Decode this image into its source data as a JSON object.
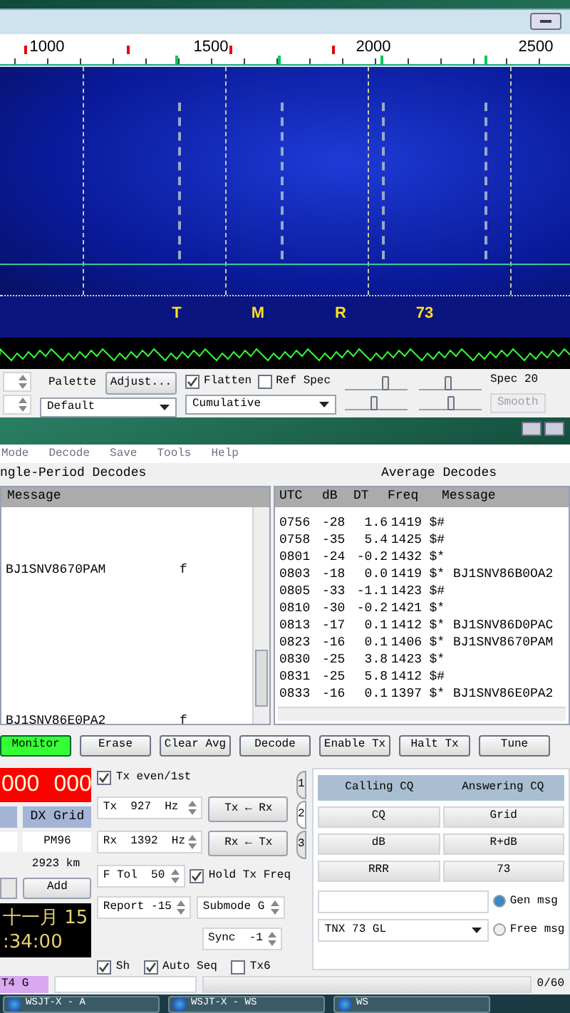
{
  "wide_graph": {
    "scale_labels": [
      "1000",
      "1500",
      "2000",
      "2500"
    ],
    "tone_labels": [
      "T",
      "M",
      "R",
      "73"
    ],
    "palette_label": "Palette",
    "adjust_button": "Adjust...",
    "flatten": {
      "label": "Flatten",
      "checked": true
    },
    "ref_spec": {
      "label": "Ref Spec",
      "checked": false
    },
    "palette": "Default",
    "spectrum_mode": "Cumulative",
    "spec_label": "Spec 20",
    "smooth_button": "Smooth",
    "sliders": [
      {
        "level": 0.65
      },
      {
        "level": 0.45
      },
      {
        "level": 0.45
      },
      {
        "level": 0.5
      }
    ]
  },
  "main_window": {
    "menu": [
      "Mode",
      "Decode",
      "Save",
      "Tools",
      "Help"
    ],
    "left_title": "ngle-Period Decodes",
    "left_columns": [
      "Message"
    ],
    "left_rows": [
      {
        "message": "BJ1SNV8670PAM",
        "flag": "f"
      },
      {
        "message": "BJ1SNV86E0PA2",
        "flag": "f"
      }
    ],
    "right_title": "Average Decodes",
    "right_columns": [
      "UTC",
      "dB",
      "DT",
      "Freq",
      "Message"
    ],
    "right_rows": [
      {
        "utc": "0756",
        "db": "-28",
        "dt": "1.6",
        "freq": "1419",
        "mark": "$#"
      },
      {
        "utc": "0758",
        "db": "-35",
        "dt": "5.4",
        "freq": "1425",
        "mark": "$#"
      },
      {
        "utc": "0801",
        "db": "-24",
        "dt": "-0.2",
        "freq": "1432",
        "mark": "$*"
      },
      {
        "utc": "0803",
        "db": "-18",
        "dt": "0.0",
        "freq": "1419",
        "mark": "$*",
        "message": "BJ1SNV86B0OA2"
      },
      {
        "utc": "0805",
        "db": "-33",
        "dt": "-1.1",
        "freq": "1423",
        "mark": "$#"
      },
      {
        "utc": "0810",
        "db": "-30",
        "dt": "-0.2",
        "freq": "1421",
        "mark": "$*"
      },
      {
        "utc": "0813",
        "db": "-17",
        "dt": "0.1",
        "freq": "1412",
        "mark": "$*",
        "message": "BJ1SNV86D0PAC"
      },
      {
        "utc": "0823",
        "db": "-16",
        "dt": "0.1",
        "freq": "1406",
        "mark": "$*",
        "message": "BJ1SNV8670PAM"
      },
      {
        "utc": "0830",
        "db": "-25",
        "dt": "3.8",
        "freq": "1423",
        "mark": "$*"
      },
      {
        "utc": "0831",
        "db": "-25",
        "dt": "5.8",
        "freq": "1412",
        "mark": "$#"
      },
      {
        "utc": "0833",
        "db": "-16",
        "dt": "0.1",
        "freq": "1397",
        "mark": "$*",
        "message": "BJ1SNV86E0PA2"
      }
    ],
    "buttons": [
      {
        "label": "Monitor",
        "on": true
      },
      {
        "label": "Erase",
        "on": false
      },
      {
        "label": "Clear Avg",
        "on": false
      },
      {
        "label": "Decode",
        "on": false
      },
      {
        "label": "Enable Tx",
        "on": false
      },
      {
        "label": "Halt Tx",
        "on": false
      },
      {
        "label": "Tune",
        "on": false
      }
    ],
    "frequency_display": [
      "000",
      "000"
    ],
    "dx_grid_label": "DX Grid",
    "dx_grid": "PM96",
    "distance": "2923 km",
    "add_button": "Add",
    "clock": {
      "date": "十一月 15",
      "time": ":34:00"
    },
    "tx_even": {
      "label": "Tx even/1st",
      "checked": true
    },
    "tx_spinner": "Tx  927  Hz",
    "rx_spinner": "Rx  1392  Hz",
    "tx_from_rx_button": "Tx ← Rx",
    "rx_from_tx_button": "Rx ← Tx",
    "ftol_spinner": "F Tol  50",
    "hold_tx_freq": {
      "label": "Hold Tx Freq",
      "checked": true
    },
    "report_spinner": "Report -15",
    "submode_spinner": "Submode G",
    "sync_spinner": "Sync  -1",
    "bottom_checks": [
      {
        "label": "Sh",
        "checked": true
      },
      {
        "label": "Auto Seq",
        "checked": true
      },
      {
        "label": "Tx6",
        "checked": false
      }
    ],
    "tabs": [
      {
        "label": "1",
        "selected": false
      },
      {
        "label": "2",
        "selected": true
      },
      {
        "label": "3",
        "selected": false
      }
    ],
    "message_header": [
      "Calling CQ",
      "Answering CQ"
    ],
    "message_buttons": [
      "CQ",
      "Grid",
      "dB",
      "R+dB",
      "RRR",
      "73"
    ],
    "radios": [
      {
        "label": "Gen msg",
        "selected": true
      },
      {
        "label": "Free msg",
        "selected": false
      }
    ],
    "free_msg_value": "TNX 73 GL",
    "status_mode": "T4 G",
    "status_count": "0/60"
  },
  "taskbar": [
    "WSJT-X - A",
    "WSJT-X - WS",
    "WS"
  ]
}
